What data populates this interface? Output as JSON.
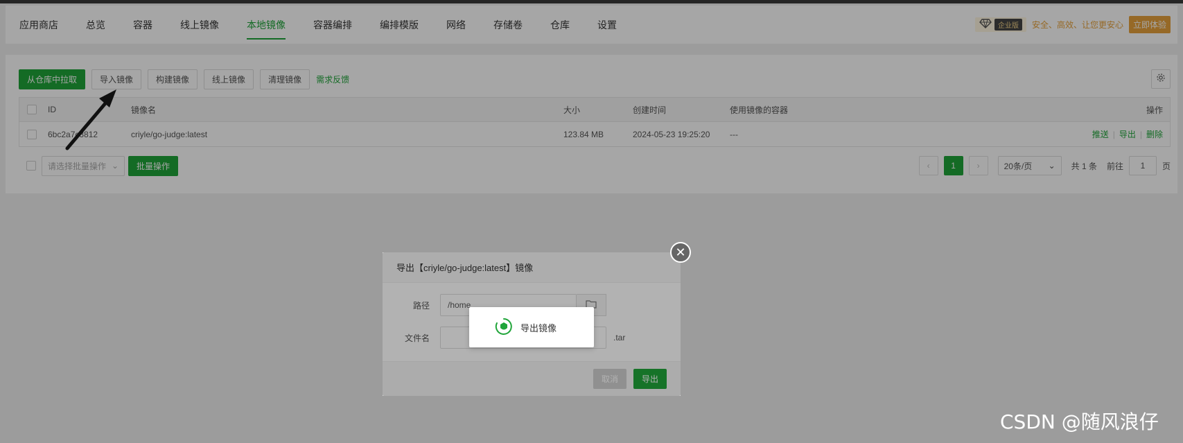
{
  "nav": {
    "tabs": [
      {
        "label": "应用商店",
        "active": false
      },
      {
        "label": "总览",
        "active": false
      },
      {
        "label": "容器",
        "active": false
      },
      {
        "label": "线上镜像",
        "active": false
      },
      {
        "label": "本地镜像",
        "active": true
      },
      {
        "label": "容器编排",
        "active": false
      },
      {
        "label": "编排模版",
        "active": false
      },
      {
        "label": "网络",
        "active": false
      },
      {
        "label": "存储卷",
        "active": false
      },
      {
        "label": "仓库",
        "active": false
      },
      {
        "label": "设置",
        "active": false
      }
    ],
    "enterprise_label": "企业版",
    "slogan": "安全、高效、让您更安心",
    "try_button": "立即体验"
  },
  "toolbar": {
    "pull_button": "从仓库中拉取",
    "import_button": "导入镜像",
    "build_button": "构建镜像",
    "online_button": "线上镜像",
    "clean_button": "清理镜像",
    "feedback_link": "需求反馈"
  },
  "table": {
    "columns": [
      "ID",
      "镜像名",
      "大小",
      "创建时间",
      "使用镜像的容器",
      "操作"
    ],
    "rows": [
      {
        "id": "6bc2a7c3812",
        "name": "criyle/go-judge:latest",
        "size": "123.84 MB",
        "created": "2024-05-23 19:25:20",
        "used_by": "---",
        "ops": [
          "推送",
          "导出",
          "删除"
        ]
      }
    ]
  },
  "footer": {
    "batch_placeholder": "请选择批量操作",
    "batch_button": "批量操作",
    "current_page": "1",
    "page_size": "20条/页",
    "total": "共 1 条",
    "goto_prefix": "前往",
    "goto_value": "1",
    "goto_suffix": "页"
  },
  "dialog": {
    "title": "导出【criyle/go-judge:latest】镜像",
    "path_label": "路径",
    "path_value": "/home",
    "filename_label": "文件名",
    "filename_value": "",
    "ext": ".tar",
    "cancel_button": "取消",
    "export_button": "导出"
  },
  "loading": {
    "text": "导出镜像"
  },
  "watermark": "CSDN @随风浪仔",
  "colors": {
    "accent": "#20a53a",
    "enterprise": "#e6a23c"
  }
}
